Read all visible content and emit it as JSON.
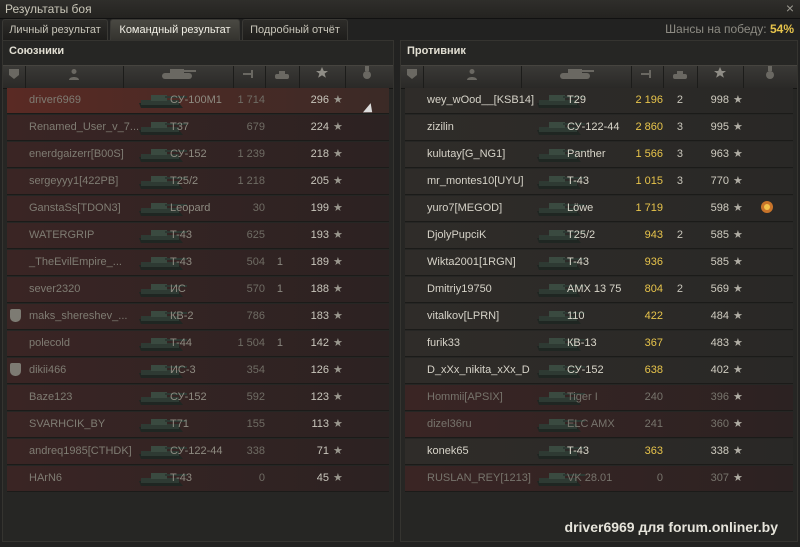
{
  "window": {
    "title": "Результаты боя",
    "close_glyph": "×"
  },
  "tabs": [
    {
      "label": "Личный результат"
    },
    {
      "label": "Командный результат"
    },
    {
      "label": "Подробный отчёт"
    }
  ],
  "chance": {
    "label": "Шансы на победу:",
    "value": "54%"
  },
  "allies": {
    "title": "Союзники",
    "rows": [
      {
        "name": "driver6969",
        "tank": "СУ-100М1",
        "dmg": "1 714",
        "kills": "",
        "xp": "296",
        "state": "me"
      },
      {
        "name": "Renamed_User_v_7...",
        "tank": "T37",
        "dmg": "679",
        "kills": "",
        "xp": "224",
        "state": "dead"
      },
      {
        "name": "enerdgaizerr[B00S]",
        "tank": "СУ-152",
        "dmg": "1 239",
        "kills": "",
        "xp": "218",
        "state": "dead"
      },
      {
        "name": "sergeyyy1[422PB]",
        "tank": "T25/2",
        "dmg": "1 218",
        "kills": "",
        "xp": "205",
        "state": "dead"
      },
      {
        "name": "GanstaSs[TDON3]",
        "tank": "Leopard",
        "dmg": "30",
        "kills": "",
        "xp": "199",
        "state": "dead"
      },
      {
        "name": "WATERGRIP",
        "tank": "T-43",
        "dmg": "625",
        "kills": "",
        "xp": "193",
        "state": "dead"
      },
      {
        "name": "_TheEvilEmpire_...",
        "tank": "T-43",
        "dmg": "504",
        "kills": "1",
        "xp": "189",
        "state": "dead"
      },
      {
        "name": "sever2320",
        "tank": "ИС",
        "dmg": "570",
        "kills": "1",
        "xp": "188",
        "state": "dead"
      },
      {
        "name": "maks_shereshev_...",
        "tank": "КВ-2",
        "dmg": "786",
        "kills": "",
        "xp": "183",
        "state": "dead",
        "badge": true
      },
      {
        "name": "polecold",
        "tank": "T-44",
        "dmg": "1 504",
        "kills": "1",
        "xp": "142",
        "state": "dead"
      },
      {
        "name": "dikii466",
        "tank": "ИС-3",
        "dmg": "354",
        "kills": "",
        "xp": "126",
        "state": "dead",
        "badge": true
      },
      {
        "name": "Baze123",
        "tank": "СУ-152",
        "dmg": "592",
        "kills": "",
        "xp": "123",
        "state": "dead"
      },
      {
        "name": "SVARHCIK_BY",
        "tank": "T71",
        "dmg": "155",
        "kills": "",
        "xp": "113",
        "state": "dead"
      },
      {
        "name": "andreq1985[CTHDK]",
        "tank": "СУ-122-44",
        "dmg": "338",
        "kills": "",
        "xp": "71",
        "state": "dead"
      },
      {
        "name": "HArN6",
        "tank": "T-43",
        "dmg": "0",
        "kills": "",
        "xp": "45",
        "state": "dead"
      }
    ]
  },
  "enemies": {
    "title": "Противник",
    "rows": [
      {
        "name": "wey_wOod__[KSB14]",
        "tank": "T29",
        "dmg": "2 196",
        "kills": "2",
        "xp": "998",
        "state": "alive"
      },
      {
        "name": "zizilin",
        "tank": "СУ-122-44",
        "dmg": "2 860",
        "kills": "3",
        "xp": "995",
        "state": "alive"
      },
      {
        "name": "kulutay[G_NG1]",
        "tank": "Panther",
        "dmg": "1 566",
        "kills": "3",
        "xp": "963",
        "state": "alive"
      },
      {
        "name": "mr_montes10[UYU]",
        "tank": "T-43",
        "dmg": "1 015",
        "kills": "3",
        "xp": "770",
        "state": "alive"
      },
      {
        "name": "yuro7[MEGOD]",
        "tank": "Löwe",
        "dmg": "1 719",
        "kills": "",
        "xp": "598",
        "state": "alive",
        "medal": true
      },
      {
        "name": "DjolyPupciK",
        "tank": "T25/2",
        "dmg": "943",
        "kills": "2",
        "xp": "585",
        "state": "alive"
      },
      {
        "name": "Wikta2001[1RGN]",
        "tank": "T-43",
        "dmg": "936",
        "kills": "",
        "xp": "585",
        "state": "alive"
      },
      {
        "name": "Dmitriy19750",
        "tank": "AMX 13 75",
        "dmg": "804",
        "kills": "2",
        "xp": "569",
        "state": "alive"
      },
      {
        "name": "vitalkov[LPRN]",
        "tank": "110",
        "dmg": "422",
        "kills": "",
        "xp": "484",
        "state": "alive"
      },
      {
        "name": "furik33",
        "tank": "КВ-13",
        "dmg": "367",
        "kills": "",
        "xp": "483",
        "state": "alive"
      },
      {
        "name": "D_xXx_nikita_xXx_D",
        "tank": "СУ-152",
        "dmg": "638",
        "kills": "",
        "xp": "402",
        "state": "alive"
      },
      {
        "name": "Hommii[APSIX]",
        "tank": "Tiger I",
        "dmg": "240",
        "kills": "",
        "xp": "396",
        "state": "dead"
      },
      {
        "name": "dizel36ru",
        "tank": "ELC AMX",
        "dmg": "241",
        "kills": "",
        "xp": "360",
        "state": "dead"
      },
      {
        "name": "konek65",
        "tank": "T-43",
        "dmg": "363",
        "kills": "",
        "xp": "338",
        "state": "alive"
      },
      {
        "name": "RUSLAN_REY[1213]",
        "tank": "VK 28.01",
        "dmg": "0",
        "kills": "",
        "xp": "307",
        "state": "dead"
      }
    ]
  },
  "icons": [
    "platoon-icon",
    "player-icon",
    "tank-icon",
    "damage-icon",
    "kills-icon",
    "xp-star-icon",
    "medal-icon"
  ],
  "watermark": "driver6969 для forum.onliner.by"
}
